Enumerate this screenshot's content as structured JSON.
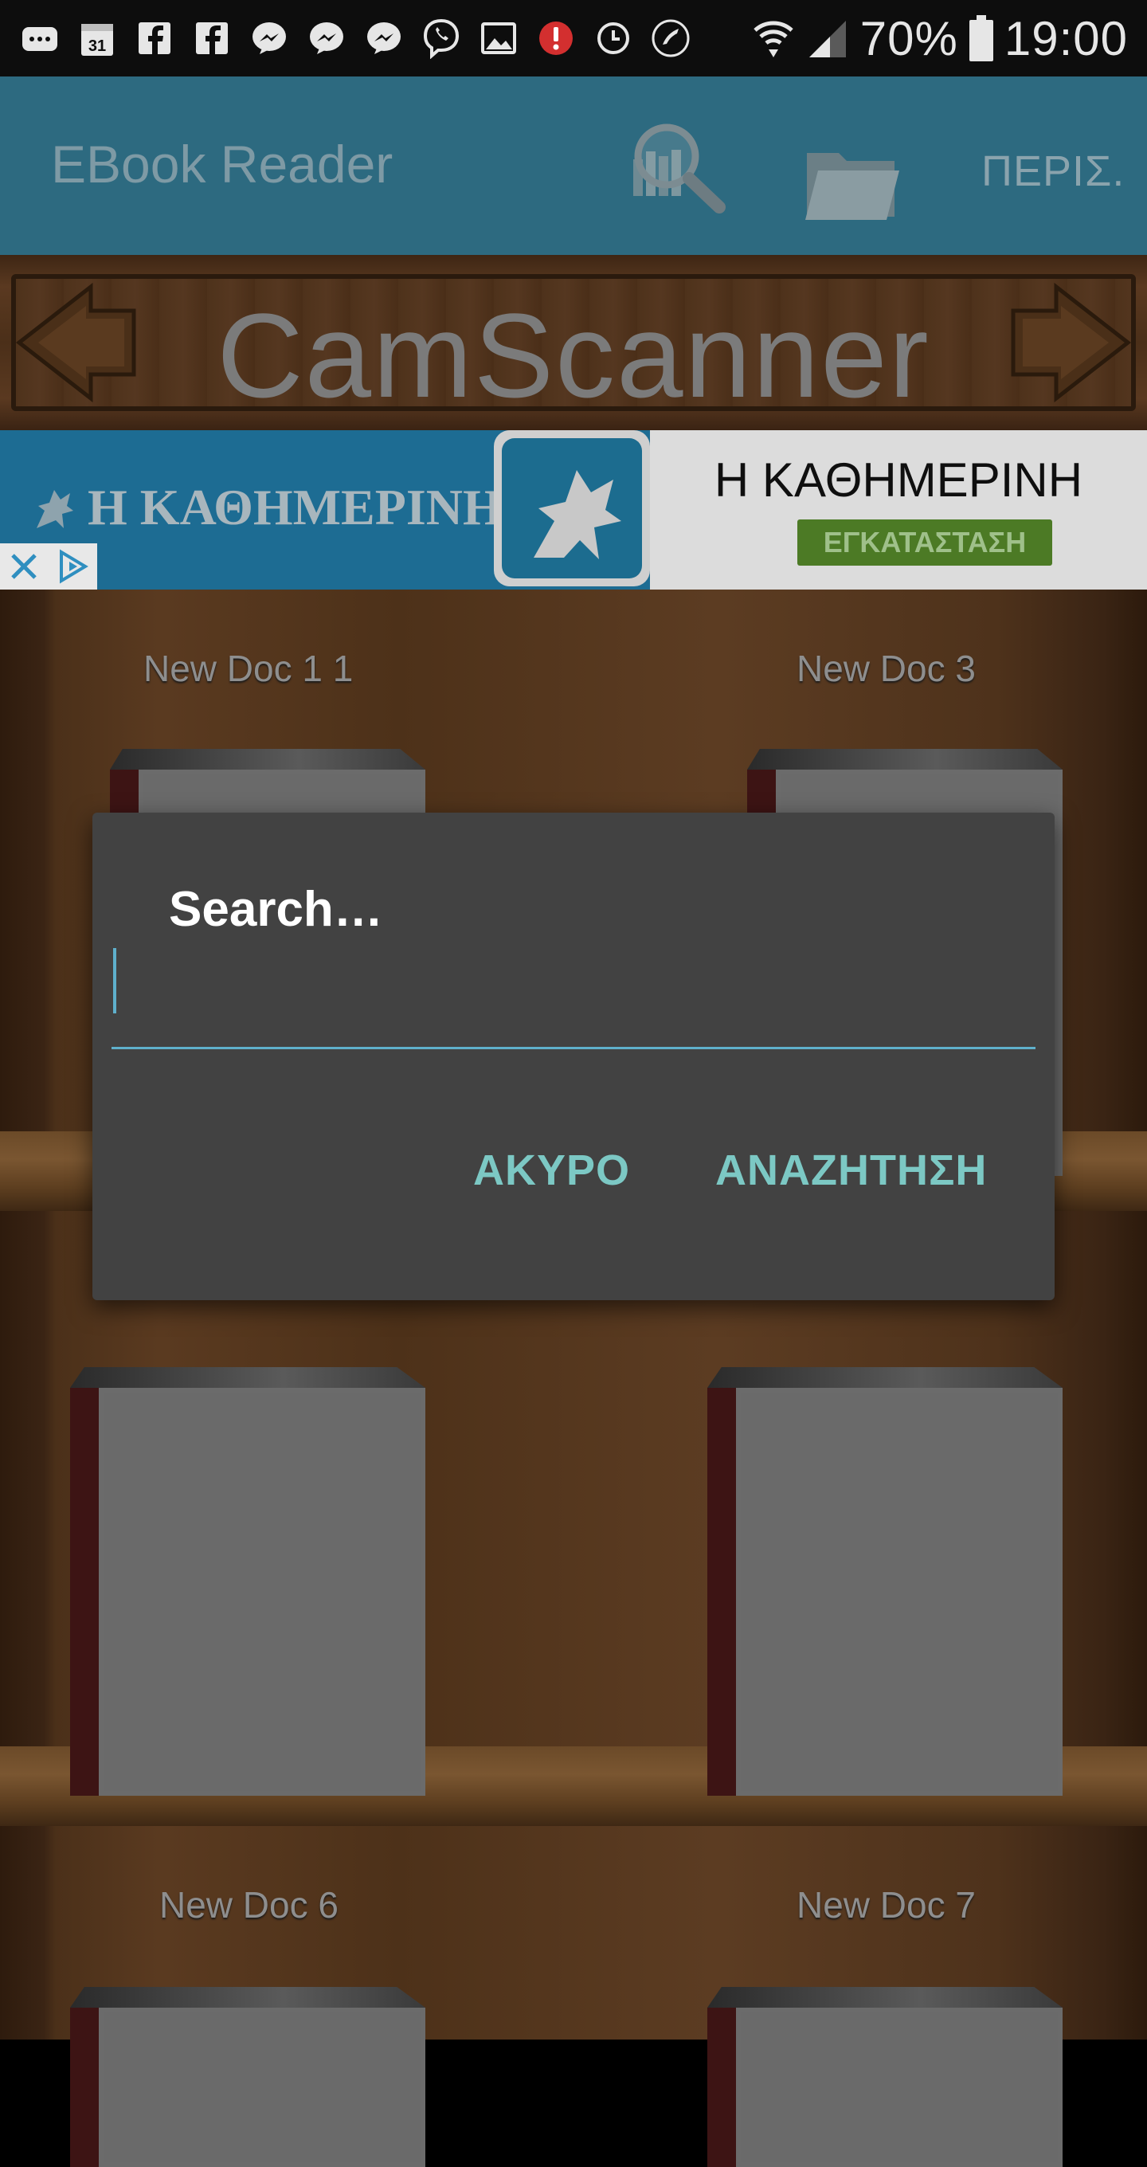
{
  "status_bar": {
    "battery": "70%",
    "time": "19:00",
    "left_icons": [
      "chat-icon",
      "calendar-icon",
      "facebook-icon",
      "facebook-icon",
      "messenger-icon",
      "messenger-icon",
      "messenger-icon",
      "viber-icon",
      "gallery-icon",
      "alert-icon",
      "alarm-icon",
      "call-icon"
    ],
    "calendar_day": "31"
  },
  "app_bar": {
    "title": "EBook Reader",
    "about_label": "ΠΕΡΙΣ."
  },
  "shelf_header": {
    "title": "CamScanner"
  },
  "ad": {
    "brand_text": "Η ΚΑΘΗΜΕΡΙΝΗ",
    "app_name": "Η ΚΑΘΗΜΕΡΙΝΗ",
    "install_label": "ΕΓΚΑΤΑΣΤΑΣΗ"
  },
  "books": [
    {
      "label": "New Doc 1 1"
    },
    {
      "label": "New Doc 3"
    },
    {
      "label": ""
    },
    {
      "label": ""
    },
    {
      "label": "New Doc 6"
    },
    {
      "label": "New Doc 7"
    }
  ],
  "dialog": {
    "title": "Search…",
    "input_value": "",
    "cancel_label": "ΑΚΥΡΟ",
    "search_label": "ΑΝΑΖΗΤΗΣΗ"
  },
  "colors": {
    "app_bar": "#2d6a80",
    "dialog_bg": "#424242",
    "dialog_accent": "#7cc8c4",
    "input_underline": "#5fb0cc",
    "install_button": "#4c7a25"
  }
}
